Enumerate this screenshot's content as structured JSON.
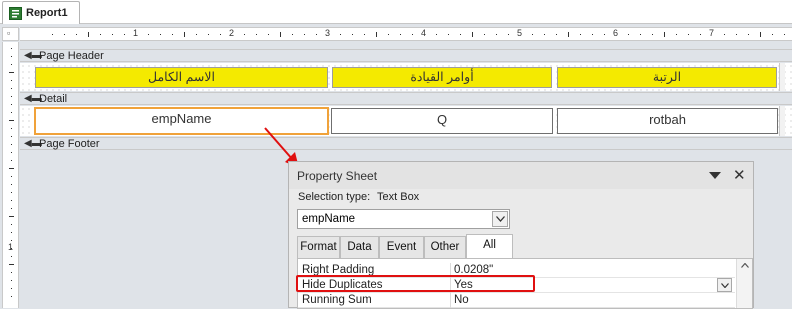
{
  "tab": {
    "title": "Report1",
    "icon": "report-icon"
  },
  "ruler": {
    "h_numbers": [
      "1",
      "2",
      "3",
      "4",
      "5",
      "6",
      "7"
    ],
    "v_numbers": [
      "1"
    ]
  },
  "sections": {
    "page_header": "Page Header",
    "detail": "Detail",
    "page_footer": "Page Footer"
  },
  "header_labels": [
    "الاسم الكامل",
    "أوامر القيادة",
    "الرتبة"
  ],
  "detail_fields": [
    "empName",
    "Q",
    "rotbah"
  ],
  "property_sheet": {
    "title": "Property Sheet",
    "selection_type_label": "Selection type:",
    "selection_type_value": "Text Box",
    "selected_control": "empName",
    "tabs": [
      "Format",
      "Data",
      "Event",
      "Other",
      "All"
    ],
    "active_tab": "All",
    "properties": [
      {
        "name": "Right Padding",
        "value": "0.0208\""
      },
      {
        "name": "Hide Duplicates",
        "value": "Yes"
      },
      {
        "name": "Running Sum",
        "value": "No"
      }
    ]
  },
  "colors": {
    "label_fill": "#f4ea00",
    "selection_border": "#f0a23a",
    "annotation": "#e01010"
  }
}
